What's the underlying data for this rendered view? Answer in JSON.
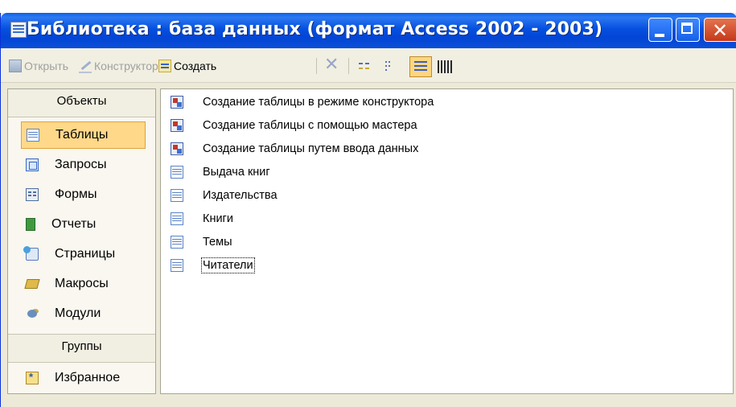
{
  "window": {
    "title": "Библиотека : база данных (формат Access 2002 - 2003)",
    "close_glyph": "✕"
  },
  "toolbar": {
    "open_label": "Открыть",
    "design_label": "Конструктор",
    "create_label": "Создать",
    "delete_glyph": "✕"
  },
  "sidebar": {
    "objects_header": "Объекты",
    "groups_header": "Группы",
    "items": [
      {
        "label": "Таблицы",
        "icon": "table-icon",
        "selected": true
      },
      {
        "label": "Запросы",
        "icon": "query-icon"
      },
      {
        "label": "Формы",
        "icon": "form-icon"
      },
      {
        "label": "Отчеты",
        "icon": "report-icon"
      },
      {
        "label": "Страницы",
        "icon": "page-icon"
      },
      {
        "label": "Макросы",
        "icon": "macro-icon"
      },
      {
        "label": "Модули",
        "icon": "module-icon"
      }
    ],
    "groups": [
      {
        "label": "Избранное",
        "icon": "favorites-icon"
      }
    ]
  },
  "list": {
    "items": [
      {
        "label": "Создание таблицы в режиме конструктора",
        "icon": "wizard-icon"
      },
      {
        "label": "Создание таблицы с помощью мастера",
        "icon": "wizard-icon"
      },
      {
        "label": "Создание таблицы путем ввода данных",
        "icon": "wizard-icon"
      },
      {
        "label": "Выдача книг",
        "icon": "table-icon"
      },
      {
        "label": "Издательства",
        "icon": "table-icon"
      },
      {
        "label": "Книги",
        "icon": "table-icon"
      },
      {
        "label": "Темы",
        "icon": "table-icon"
      },
      {
        "label": "Читатели",
        "icon": "table-icon",
        "focused": true
      }
    ]
  }
}
